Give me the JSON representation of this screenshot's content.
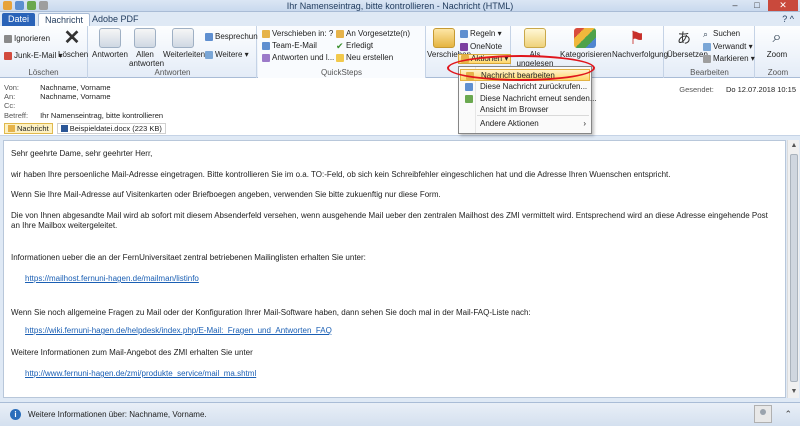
{
  "window": {
    "title": "Ihr Namenseintrag, bitte kontrollieren - Nachricht (HTML)",
    "min": "–",
    "max": "□",
    "close": "✕"
  },
  "tabs": [
    "Datei",
    "Nachricht",
    "Adobe PDF"
  ],
  "help": "? ^",
  "ribbon": {
    "loeschen": {
      "label": "Löschen",
      "ignorieren": "Ignorieren",
      "junk": "Junk-E-Mail ▾",
      "loeschen": "Löschen"
    },
    "antworten": {
      "label": "Antworten",
      "antworten": "Antworten",
      "allen": "Allen antworten",
      "weiterleiten": "Weiterleiten",
      "besprechung": "Besprechung",
      "weitere": "Weitere ▾"
    },
    "quicksteps": {
      "label": "QuickSteps",
      "items": [
        "Verschieben in: ?",
        "Team-E-Mail",
        "Antworten und l...",
        "An Vorgesetzte(n)",
        "Erledigt",
        "Neu erstellen"
      ]
    },
    "verschieben": {
      "label": "Versc",
      "verschieben": "Verschieben",
      "regeln": "Regeln ▾",
      "onenote": "OneNote",
      "aktionen": "Aktionen ▾"
    },
    "kategorien": {
      "ungelesen": "Als ungelesen markieren",
      "kategorisieren": "Kategorisieren",
      "nachverfolgung": "Nachverfolgung"
    },
    "bearbeiten": {
      "label": "Bearbeiten",
      "uebersetzen": "Übersetzen",
      "suchen": "Suchen",
      "verwandt": "Verwandt ▾",
      "markieren": "Markieren ▾"
    },
    "zoom": {
      "label": "Zoom",
      "zoom": "Zoom"
    }
  },
  "menu": {
    "items": [
      "Nachricht bearbeiten",
      "Diese Nachricht zurückrufen...",
      "Diese Nachricht erneut senden...",
      "Ansicht im Browser",
      "Andere Aktionen"
    ]
  },
  "header": {
    "von_label": "Von:",
    "von": "Nachname, Vorname",
    "an_label": "An:",
    "an": "Nachname, Vorname",
    "cc_label": "Cc:",
    "cc": "",
    "betreff_label": "Betreff:",
    "betreff": "Ihr Namenseintrag, bitte kontrollieren",
    "gesendet_label": "Gesendet:",
    "gesendet": "Do 12.07.2018 10:15",
    "attachments": [
      "Nachricht",
      "Beispieldatei.docx (223 KB)"
    ]
  },
  "body": {
    "greeting": "Sehr geehrte Dame, sehr geehrter Herr,",
    "p1": "wir haben Ihre persoenliche Mail-Adresse eingetragen. Bitte kontrollieren Sie im o.a. TO:-Feld, ob sich kein Schreibfehler eingeschlichen hat und die Adresse Ihren Wuenschen entspricht.",
    "p2": "Wenn Sie Ihre Mail-Adresse auf Visitenkarten oder Briefboegen angeben, verwenden Sie bitte zukuenftig nur diese Form.",
    "p3a": "Die von Ihnen abgesandte Mail wird ab sofort mit diesem Absenderfeld versehen, wenn ausgehende Mail ueber den zentralen Mailhost des ZMI vermittelt wird. Entsprechend wird an diese Adresse eingehende Post",
    "p3b": "an Ihre Mailbox weitergeleitet.",
    "p4": "Informationen ueber die an der FernUniversitaet zentral betriebenen Mailinglisten erhalten Sie unter:",
    "link1": "https://mailhost.fernuni-hagen.de/mailman/listinfo",
    "p5": "Wenn Sie noch allgemeine Fragen zu Mail oder der Konfiguration Ihrer Mail-Software haben, dann sehen Sie doch mal in der Mail-FAQ-Liste nach:",
    "link2": "https://wiki.fernuni-hagen.de/helpdesk/index.php/E-Mail:_Fragen_und_Antworten_FAQ",
    "p6": "Weitere Informationen zum Mail-Angebot des ZMI erhalten Sie unter",
    "link3": "http://www.fernuni-hagen.de/zmi/produkte_service/mail_ma.shtml"
  },
  "status": {
    "text": "Weitere Informationen über: Nachname, Vorname."
  }
}
